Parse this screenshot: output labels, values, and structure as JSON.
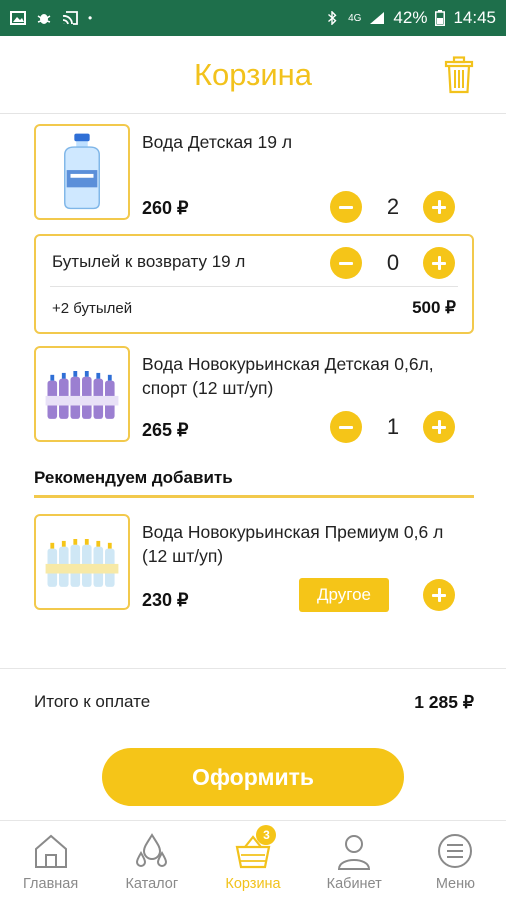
{
  "status_bar": {
    "battery": "42%",
    "time": "14:45",
    "network": "4G"
  },
  "header": {
    "title": "Корзина"
  },
  "cart_items": [
    {
      "name": "Вода Детская 19 л",
      "price": "260 ₽",
      "qty": "2"
    },
    {
      "name": "Вода Новокурьинская Детская 0,6л, спорт (12 шт/уп)",
      "price": "265 ₽",
      "qty": "1"
    }
  ],
  "bottle_return": {
    "label": "Бутылей к возврату 19 л",
    "qty": "0",
    "note": "+2 бутылей",
    "amount": "500 ₽"
  },
  "recommend": {
    "title": "Рекомендуем добавить",
    "item": {
      "name": "Вода Новокурьинская Премиум 0,6 л (12 шт/уп)",
      "price": "230 ₽",
      "other_label": "Другое"
    }
  },
  "total": {
    "label": "Итого к оплате",
    "value": "1 285 ₽"
  },
  "checkout_label": "Оформить",
  "tabs": [
    {
      "label": "Главная",
      "icon": "home-icon"
    },
    {
      "label": "Каталог",
      "icon": "drops-icon"
    },
    {
      "label": "Корзина",
      "icon": "basket-icon",
      "badge": "3",
      "active": true
    },
    {
      "label": "Кабинет",
      "icon": "user-icon"
    },
    {
      "label": "Меню",
      "icon": "menu-icon"
    }
  ],
  "colors": {
    "accent": "#f5c518",
    "statusbar": "#1e6f4b",
    "tab_inactive": "#8a8a8a"
  }
}
